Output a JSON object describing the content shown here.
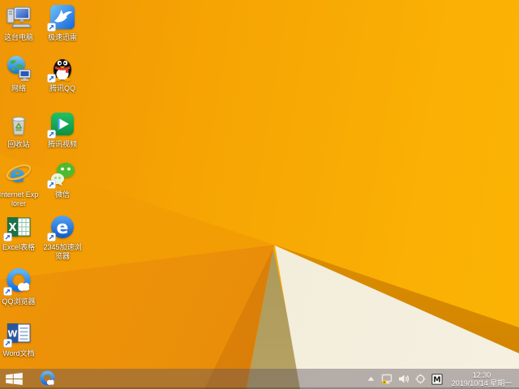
{
  "desktop": {
    "icons": [
      {
        "label": "这台电脑",
        "icon": "computer-icon",
        "shortcut": false
      },
      {
        "label": "极速迅雷",
        "icon": "thunder-bird-icon",
        "shortcut": true
      },
      {
        "label": "网络",
        "icon": "network-globe-icon",
        "shortcut": false
      },
      {
        "label": "腾讯QQ",
        "icon": "qq-penguin-icon",
        "shortcut": true
      },
      {
        "label": "回收站",
        "icon": "recycle-bin-icon",
        "shortcut": false
      },
      {
        "label": "腾讯视频",
        "icon": "tencent-video-icon",
        "shortcut": true
      },
      {
        "label": "Internet Explorer",
        "icon": "internet-explorer-icon",
        "shortcut": false
      },
      {
        "label": "微信",
        "icon": "wechat-icon",
        "shortcut": true
      },
      {
        "label": "Excel表格",
        "icon": "excel-icon",
        "shortcut": true
      },
      {
        "label": "2345加速浏览器",
        "icon": "browser-2345-icon",
        "shortcut": true
      },
      {
        "label": "QQ浏览器",
        "icon": "qq-browser-icon",
        "shortcut": true
      },
      {
        "label": "Word文档",
        "icon": "word-icon",
        "shortcut": true
      }
    ]
  },
  "taskbar": {
    "start_icon": "windows-logo-icon",
    "pinned_apps": [
      {
        "label": "QQ浏览器",
        "icon": "qq-browser-icon"
      }
    ],
    "tray": {
      "icons": [
        "hidden-icons-chevron-icon",
        "security-warning-icon",
        "volume-icon",
        "action-center-icon",
        "ime-indicator-icon"
      ],
      "ime_letter": "M",
      "time": "12:30",
      "date": "2019/10/14 星期一"
    }
  },
  "colors": {
    "wallpaper_orange": "#f6a403",
    "wallpaper_cream": "#f2ecda",
    "wallpaper_tan": "#a99554",
    "wallpaper_stripe": "#d18300",
    "taskbar_tint": "rgba(92,84,96,0.42)"
  }
}
